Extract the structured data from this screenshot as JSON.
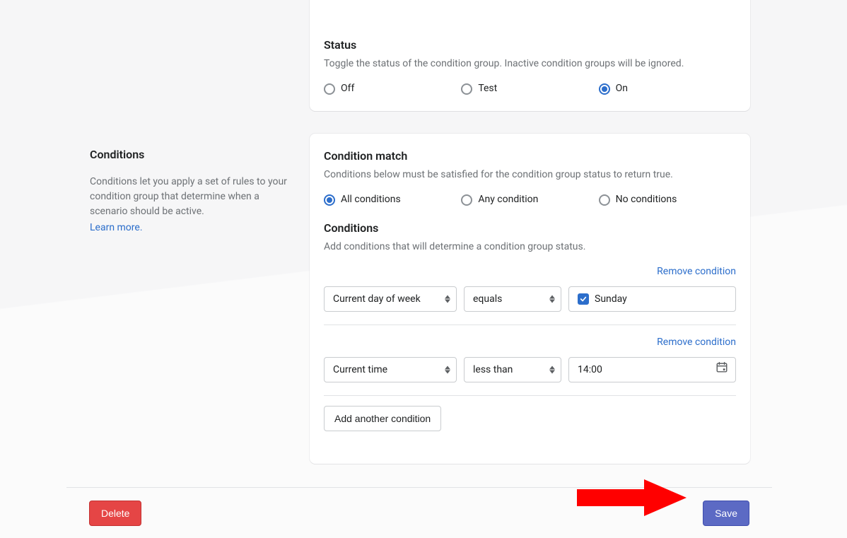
{
  "sidebar": {
    "title": "Conditions",
    "desc": "Conditions let you apply a set of rules to your condition group that determine when a scenario should be active.",
    "learn_more": "Learn more."
  },
  "status": {
    "title": "Status",
    "desc": "Toggle the status of the condition group. Inactive condition groups will be ignored.",
    "options": [
      "Off",
      "Test",
      "On"
    ],
    "selected": "On"
  },
  "match": {
    "title": "Condition match",
    "desc": "Conditions below must be satisfied for the condition group status to return true.",
    "options": [
      "All conditions",
      "Any condition",
      "No conditions"
    ],
    "selected": "All conditions"
  },
  "conditions_section": {
    "title": "Conditions",
    "desc": "Add conditions that will determine a condition group status.",
    "remove_label": "Remove condition",
    "add_label": "Add another condition",
    "rows": [
      {
        "field": "Current day of week",
        "op": "equals",
        "value": "Sunday",
        "type": "checkbox"
      },
      {
        "field": "Current time",
        "op": "less than",
        "value": "14:00",
        "type": "datetime"
      }
    ]
  },
  "footer": {
    "delete": "Delete",
    "save": "Save"
  }
}
